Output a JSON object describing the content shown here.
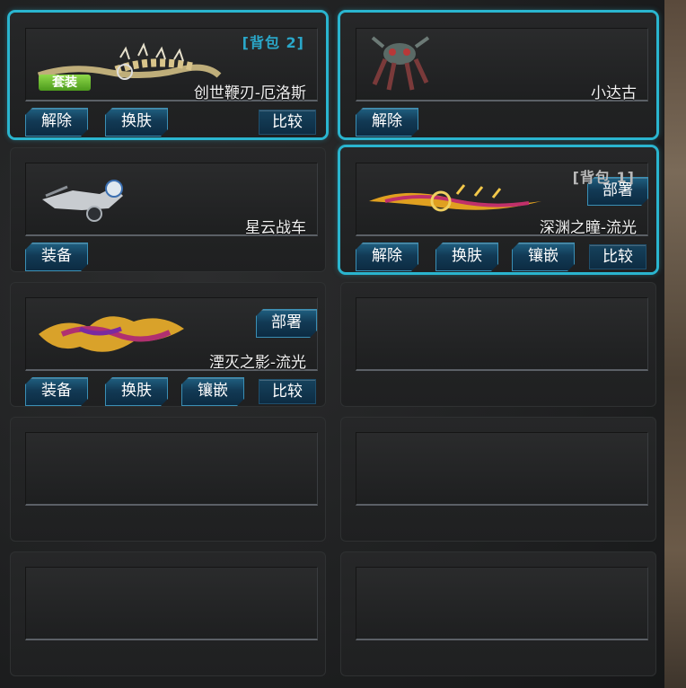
{
  "slots": [
    {
      "name": "创世鞭刃-厄洛斯",
      "bag": "[背包 2]",
      "badge": "套装",
      "buttons": [
        "解除",
        "换肤"
      ],
      "compare": "比较"
    },
    {
      "name": "小达古",
      "buttons": [
        "解除"
      ]
    },
    {
      "name": "星云战车",
      "buttons": [
        "装备"
      ]
    },
    {
      "name": "深渊之瞳-流光",
      "bag": "[背包 1]",
      "deploy": "部署",
      "buttons": [
        "解除",
        "换肤",
        "镶嵌"
      ],
      "compare": "比较"
    },
    {
      "name": "湮灭之影-流光",
      "deploy": "部署",
      "buttons": [
        "装备",
        "换肤",
        "镶嵌"
      ],
      "compare": "比较"
    }
  ],
  "colors": {
    "selected_border": "#2ab5cf",
    "button_blue": "#1f5f80",
    "set_badge_green": "#6fbf2e"
  },
  "icons": {
    "weapon_1": "whip-blade-icon",
    "weapon_2": "mech-robot-icon",
    "weapon_3": "vehicle-icon",
    "weapon_4": "flame-sword-icon",
    "weapon_5": "flame-shadow-icon"
  }
}
